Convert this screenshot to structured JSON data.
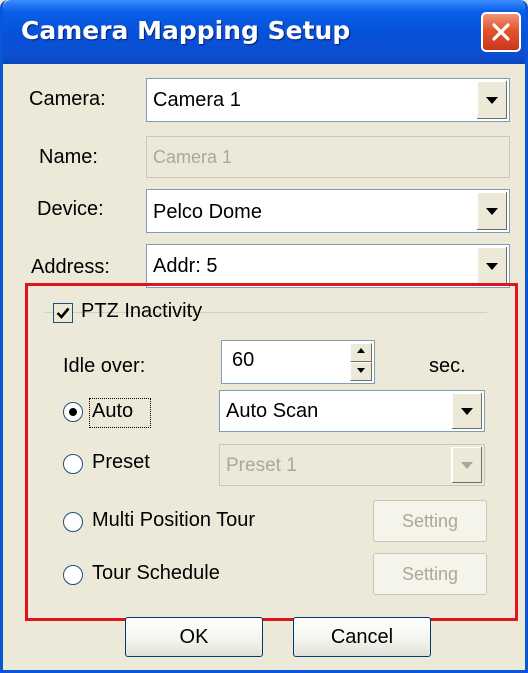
{
  "window": {
    "title": "Camera Mapping Setup"
  },
  "fields": {
    "camera": {
      "label": "Camera:",
      "value": "Camera 1"
    },
    "name": {
      "label": "Name:",
      "value": "Camera 1"
    },
    "device": {
      "label": "Device:",
      "value": "Pelco Dome"
    },
    "address": {
      "label": "Address:",
      "value": "Addr: 5"
    }
  },
  "ptz": {
    "checkbox_label": "PTZ Inactivity",
    "checked": true,
    "idle_label": "Idle over:",
    "idle_value": "60",
    "idle_unit": "sec.",
    "options": [
      {
        "label": "Auto",
        "selected": true,
        "select_value": "Auto Scan",
        "enabled": true
      },
      {
        "label": "Preset",
        "selected": false,
        "select_value": "Preset 1",
        "enabled": false
      },
      {
        "label": "Multi Position Tour",
        "selected": false,
        "button_label": "Setting"
      },
      {
        "label": "Tour Schedule",
        "selected": false,
        "button_label": "Setting"
      }
    ]
  },
  "buttons": {
    "ok_label": "OK",
    "cancel_label": "Cancel"
  },
  "colors": {
    "title_blue": "#0650d8",
    "highlight_red": "#e0141c",
    "dialog_bg": "#ece9d8"
  }
}
